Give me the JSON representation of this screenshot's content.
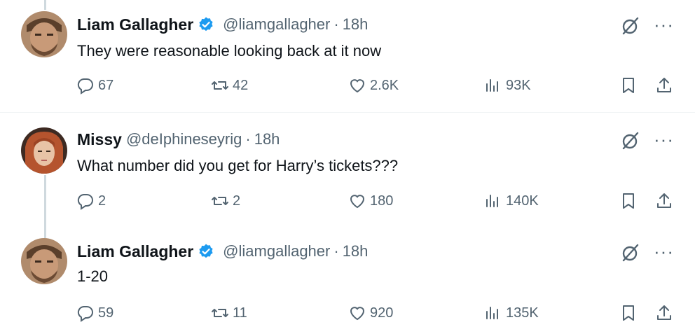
{
  "tweets": [
    {
      "name": "Liam Gallagher",
      "verified": true,
      "handle": "@liamgallagher",
      "sep": "·",
      "time": "18h",
      "text": "They were reasonable looking back at it now",
      "replies": "67",
      "reposts": "42",
      "likes": "2.6K",
      "views": "93K"
    },
    {
      "name": "Missy",
      "verified": false,
      "handle": "@deIphineseyrig",
      "sep": "·",
      "time": "18h",
      "text": "What number did you get for Harry’s tickets???",
      "replies": "2",
      "reposts": "2",
      "likes": "180",
      "views": "140K"
    },
    {
      "name": "Liam Gallagher",
      "verified": true,
      "handle": "@liamgallagher",
      "sep": "·",
      "time": "18h",
      "text": "1-20",
      "replies": "59",
      "reposts": "11",
      "likes": "920",
      "views": "135K"
    }
  ],
  "more_glyph": "···",
  "colors": {
    "verified": "#1d9bf0",
    "muted": "#536471",
    "thread": "#cfd9de"
  }
}
